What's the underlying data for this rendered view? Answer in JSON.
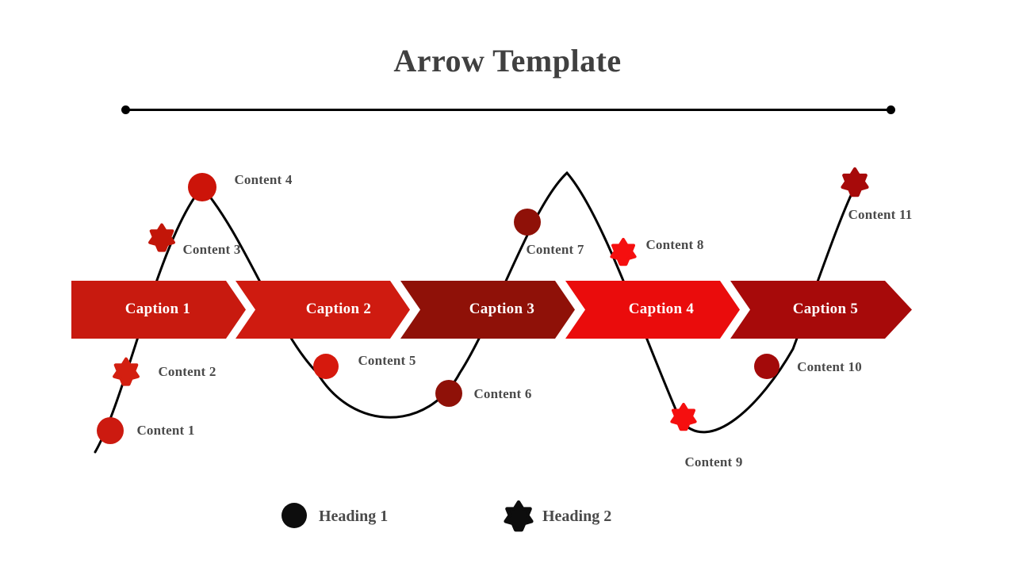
{
  "page": {
    "title": "Arrow Template",
    "background_color": "#ffffff",
    "title_color": "#404040"
  },
  "divider": {
    "name": "horizontal-rule",
    "color": "#000000",
    "left_dot": "•",
    "right_dot": "•"
  },
  "ribbon": {
    "segments": [
      {
        "label": "Caption 1",
        "color": "#c81a0f",
        "text_color": "#ffffff"
      },
      {
        "label": "Caption 2",
        "color": "#cf1b10",
        "text_color": "#ffffff"
      },
      {
        "label": "Caption 3",
        "color": "#8f1108",
        "text_color": "#ffffff"
      },
      {
        "label": "Caption 4",
        "color": "#ea0c0c",
        "text_color": "#ffffff"
      },
      {
        "label": "Caption 5",
        "color": "#a70a0a",
        "text_color": "#ffffff"
      }
    ]
  },
  "markers": [
    {
      "label": "Content 1",
      "shape": "circle",
      "color": "#cc1a10"
    },
    {
      "label": "Content 2",
      "shape": "star",
      "color": "#d31f10"
    },
    {
      "label": "Content 3",
      "shape": "star",
      "color": "#c21609"
    },
    {
      "label": "Content 4",
      "shape": "circle",
      "color": "#cc1409"
    },
    {
      "label": "Content 5",
      "shape": "circle",
      "color": "#d6190d"
    },
    {
      "label": "Content 6",
      "shape": "circle",
      "color": "#8f1108"
    },
    {
      "label": "Content 7",
      "shape": "circle",
      "color": "#8f1108"
    },
    {
      "label": "Content 8",
      "shape": "star",
      "color": "#f50f0f"
    },
    {
      "label": "Content 9",
      "shape": "star",
      "color": "#f50f0f"
    },
    {
      "label": "Content 10",
      "shape": "circle",
      "color": "#a30a0a"
    },
    {
      "label": "Content 11",
      "shape": "star",
      "color": "#a70a0a"
    }
  ],
  "legend": {
    "items": [
      {
        "label": "Heading 1",
        "shape": "circle",
        "color": "#0d0d0d"
      },
      {
        "label": "Heading 2",
        "shape": "star",
        "color": "#0d0d0d"
      }
    ]
  },
  "curve": {
    "color": "#000000",
    "stroke_width": 3
  }
}
